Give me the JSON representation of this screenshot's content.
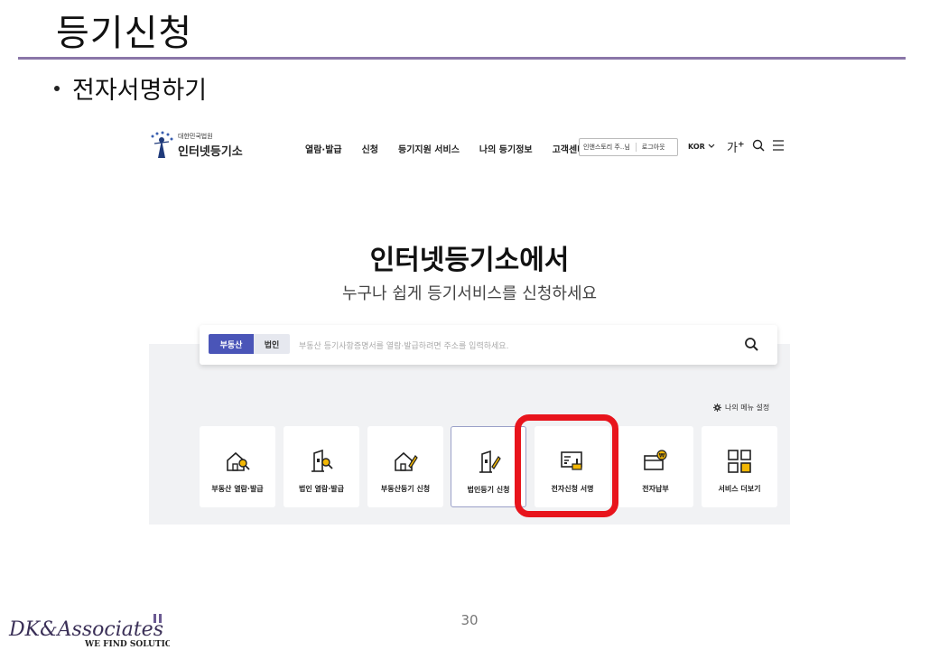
{
  "slide": {
    "title": "등기신청",
    "bullet": "전자서명하기",
    "page_number": "30",
    "brand_name": "DK&Associates",
    "brand_tagline": "WE FIND SOLUTIONS"
  },
  "site": {
    "logo_sub": "대한민국법원",
    "logo_main": "인터넷등기소",
    "nav": [
      "열람·발급",
      "신청",
      "등기지원 서비스",
      "나의 등기정보",
      "고객센터"
    ],
    "user_name": "인앤스토리 주..님",
    "logout": "로그아웃",
    "language": "KOR",
    "font_size_button": "가",
    "hero_title": "인터넷등기소에서",
    "hero_subtitle": "누구나 쉽게 등기서비스를 신청하세요",
    "search": {
      "tabs": [
        "부동산",
        "법인"
      ],
      "active_tab": "부동산",
      "placeholder": "부동산 등기사항증명서를 열람·발급하려면 주소를 입력하세요."
    },
    "menu_settings": "나의 메뉴 설정",
    "services": [
      {
        "label": "부동산 열람·발급",
        "icon": "house-search-icon"
      },
      {
        "label": "법인 열람·발급",
        "icon": "building-search-icon"
      },
      {
        "label": "부동산등기 신청",
        "icon": "house-pen-icon"
      },
      {
        "label": "법인등기 신청",
        "icon": "building-pen-icon",
        "selected": true
      },
      {
        "label": "전자신청 서명",
        "icon": "e-sign-icon",
        "highlighted": true
      },
      {
        "label": "전자납부",
        "icon": "card-payment-icon"
      },
      {
        "label": "서비스 더보기",
        "icon": "grid-more-icon"
      }
    ],
    "colors": {
      "accent": "#4a55b8",
      "highlight": "#e8141c",
      "icon_yellow": "#f2b705",
      "rule": "#8a76a8"
    }
  }
}
